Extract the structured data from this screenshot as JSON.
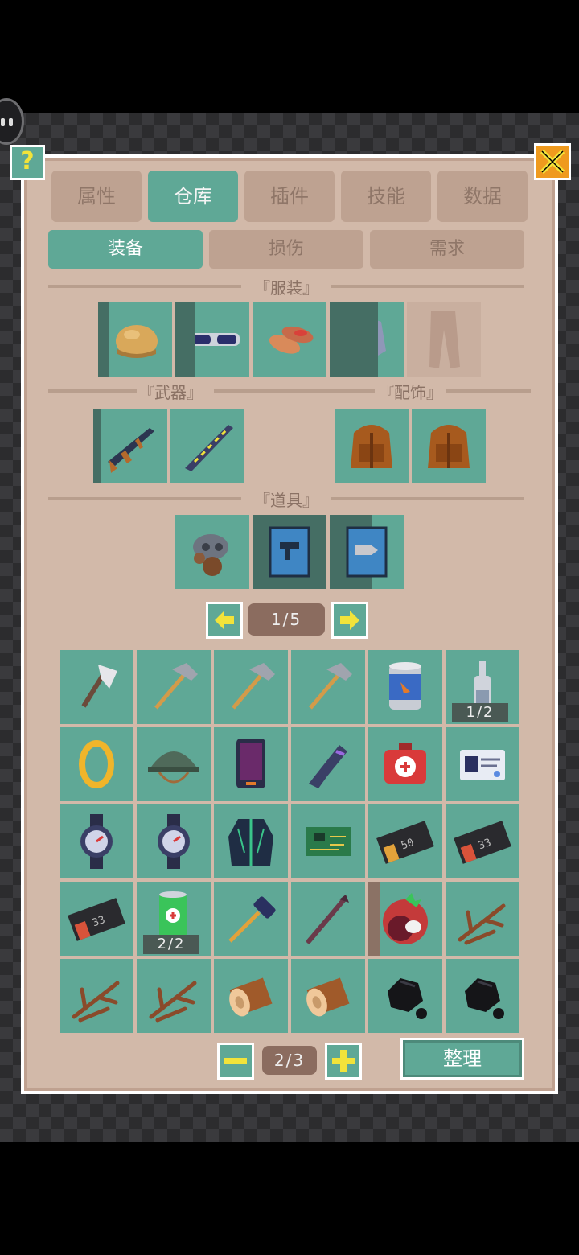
{
  "top_tabs": [
    "属性",
    "仓库",
    "插件",
    "技能",
    "数据"
  ],
  "active_top_tab": "仓库",
  "sub_tabs": [
    "装备",
    "损伤",
    "需求"
  ],
  "active_sub_tab": "装备",
  "sections": {
    "clothing": "『服装』",
    "weapons": "『武器』",
    "accessories": "『配饰』",
    "tools": "『道具』"
  },
  "help_label": "?",
  "clothing_slots": [
    "hat-icon",
    "goggles-icon",
    "gloves-icon",
    "armor-vest-icon",
    "pants-icon"
  ],
  "weapon_slots": [
    "assault-rifle-icon",
    "blade-icon"
  ],
  "accessory_slots": [
    "backpack-icon",
    "backpack-icon"
  ],
  "tool_slots": [
    "gas-mask-icon",
    "smg-book-icon",
    "ammo-book-icon"
  ],
  "equip_pager": {
    "label": "1/5"
  },
  "inventory": [
    {
      "icon": "axe-icon"
    },
    {
      "icon": "hammer-icon"
    },
    {
      "icon": "hammer-icon"
    },
    {
      "icon": "hammer-icon"
    },
    {
      "icon": "canned-food-icon"
    },
    {
      "icon": "bottle-icon",
      "qty": "1/2"
    },
    {
      "icon": "ring-icon"
    },
    {
      "icon": "helmet-icon"
    },
    {
      "icon": "phone-icon"
    },
    {
      "icon": "pistol-icon"
    },
    {
      "icon": "medkit-icon"
    },
    {
      "icon": "id-card-icon"
    },
    {
      "icon": "watch-icon"
    },
    {
      "icon": "watch-icon"
    },
    {
      "icon": "jacket-icon"
    },
    {
      "icon": "circuit-board-icon"
    },
    {
      "icon": "ticket-50-icon"
    },
    {
      "icon": "ticket-33-icon"
    },
    {
      "icon": "ticket-33-icon"
    },
    {
      "icon": "soda-can-icon",
      "qty": "2/2"
    },
    {
      "icon": "mallet-icon"
    },
    {
      "icon": "stick-icon"
    },
    {
      "icon": "tomato-icon"
    },
    {
      "icon": "twigs-icon"
    },
    {
      "icon": "twigs-icon"
    },
    {
      "icon": "twigs-icon"
    },
    {
      "icon": "log-icon"
    },
    {
      "icon": "log-icon"
    },
    {
      "icon": "coal-icon"
    },
    {
      "icon": "coal-icon"
    }
  ],
  "inventory_pager": {
    "label": "2/3"
  },
  "sort_button": "整理",
  "colors": {
    "accent": "#5fa896",
    "panel": "#d2b9a9",
    "tab_inactive": "#bea291",
    "arrow": "#f2e33a",
    "close": "#ef9a1e"
  }
}
